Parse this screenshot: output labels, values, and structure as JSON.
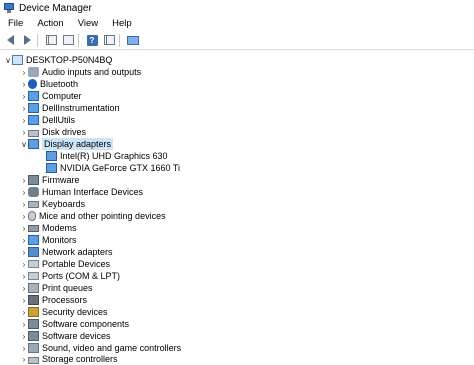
{
  "window": {
    "title": "Device Manager"
  },
  "menu": [
    "File",
    "Action",
    "View",
    "Help"
  ],
  "toolbar": {
    "buttons": [
      "back-icon",
      "forward-icon",
      "show-hide-console-tree-icon",
      "properties-icon",
      "help-icon",
      "action-pane-icon",
      "scan-hardware-icon"
    ]
  },
  "tree": {
    "root": "DESKTOP-P50N4BQ",
    "items": [
      {
        "label": "Audio inputs and outputs",
        "icon": "speaker-icon",
        "expanded": false
      },
      {
        "label": "Bluetooth",
        "icon": "bluetooth-icon",
        "expanded": false
      },
      {
        "label": "Computer",
        "icon": "computer-icon",
        "expanded": false
      },
      {
        "label": "DellInstrumentation",
        "icon": "monitor-icon",
        "expanded": false
      },
      {
        "label": "DellUtils",
        "icon": "monitor-icon",
        "expanded": false
      },
      {
        "label": "Disk drives",
        "icon": "disk-icon",
        "expanded": false
      },
      {
        "label": "Display adapters",
        "icon": "display-adapter-icon",
        "expanded": true,
        "selected": true,
        "children": [
          "Intel(R) UHD Graphics 630",
          "NVIDIA GeForce GTX 1660 Ti"
        ]
      },
      {
        "label": "Firmware",
        "icon": "chip-icon",
        "expanded": false
      },
      {
        "label": "Human Interface Devices",
        "icon": "hid-icon",
        "expanded": false
      },
      {
        "label": "Keyboards",
        "icon": "keyboard-icon",
        "expanded": false
      },
      {
        "label": "Mice and other pointing devices",
        "icon": "mouse-icon",
        "expanded": false
      },
      {
        "label": "Modems",
        "icon": "modem-icon",
        "expanded": false
      },
      {
        "label": "Monitors",
        "icon": "monitor-icon",
        "expanded": false
      },
      {
        "label": "Network adapters",
        "icon": "network-icon",
        "expanded": false
      },
      {
        "label": "Portable Devices",
        "icon": "portable-device-icon",
        "expanded": false
      },
      {
        "label": "Ports (COM & LPT)",
        "icon": "port-icon",
        "expanded": false
      },
      {
        "label": "Print queues",
        "icon": "printer-icon",
        "expanded": false
      },
      {
        "label": "Processors",
        "icon": "processor-icon",
        "expanded": false
      },
      {
        "label": "Security devices",
        "icon": "security-icon",
        "expanded": false
      },
      {
        "label": "Software components",
        "icon": "component-icon",
        "expanded": false
      },
      {
        "label": "Software devices",
        "icon": "component-icon",
        "expanded": false
      },
      {
        "label": "Sound, video and game controllers",
        "icon": "sound-icon",
        "expanded": false
      },
      {
        "label": "Storage controllers",
        "icon": "storage-icon",
        "expanded": false
      }
    ]
  },
  "colors": {
    "selection": "#cce4f7",
    "accent": "#3a78c6"
  }
}
